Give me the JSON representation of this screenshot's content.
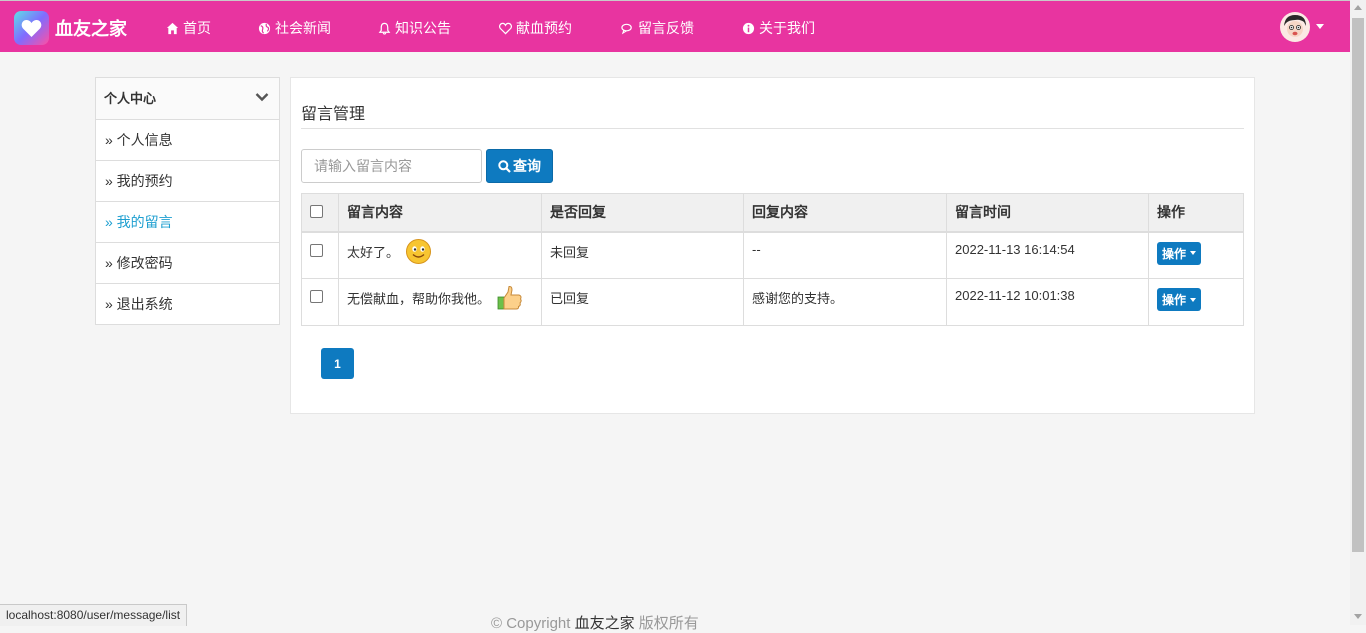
{
  "brand": {
    "name": "血友之家",
    "accent": "#e834a0"
  },
  "nav": [
    {
      "label": "首页",
      "icon": "home-icon"
    },
    {
      "label": "社会新闻",
      "icon": "globe-icon"
    },
    {
      "label": "知识公告",
      "icon": "bell-icon"
    },
    {
      "label": "献血预约",
      "icon": "heart-icon"
    },
    {
      "label": "留言反馈",
      "icon": "comments-icon"
    },
    {
      "label": "关于我们",
      "icon": "info-circle-icon"
    }
  ],
  "sidebar": {
    "title": "个人中心",
    "items": [
      {
        "label": "» 个人信息"
      },
      {
        "label": "» 我的预约"
      },
      {
        "label": "» 我的留言",
        "active": true
      },
      {
        "label": "» 修改密码"
      },
      {
        "label": "» 退出系统"
      }
    ]
  },
  "main": {
    "title": "留言管理",
    "search": {
      "placeholder": "请输入留言内容",
      "button": "查询"
    },
    "table": {
      "headers": [
        "留言内容",
        "是否回复",
        "回复内容",
        "留言时间",
        "操作"
      ],
      "rows": [
        {
          "content": "太好了。",
          "replied": "未回复",
          "reply": "--",
          "time": "2022-11-13 16:14:54",
          "action": "操作",
          "emoji": "smile-emoji"
        },
        {
          "content": "无偿献血，帮助你我他。",
          "replied": "已回复",
          "reply": "感谢您的支持。",
          "time": "2022-11-12 10:01:38",
          "action": "操作",
          "emoji": "thumbs-up-emoji"
        }
      ]
    },
    "pagination": {
      "current": "1"
    }
  },
  "footer": {
    "prefix": "© Copyright ",
    "brand": "血友之家",
    "suffix": " 版权所有"
  },
  "statusbar": {
    "url": "localhost:8080/user/message/list"
  }
}
